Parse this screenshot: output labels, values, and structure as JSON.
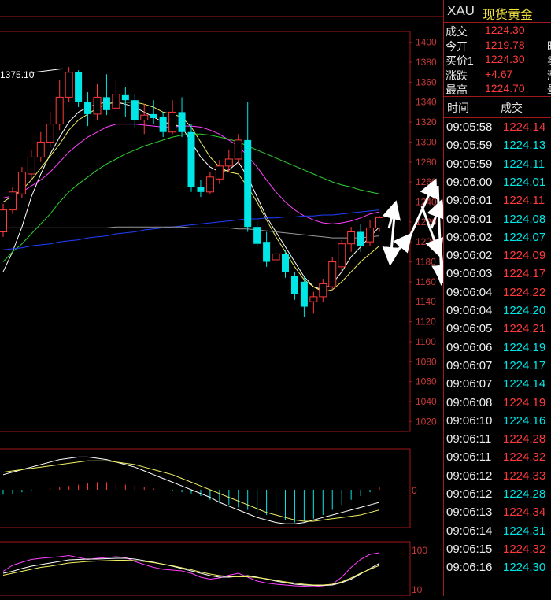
{
  "symbol": "XAU",
  "instrument_name": "现货黄金",
  "quote": [
    {
      "label": "成交",
      "value": "1224.30",
      "cut": ""
    },
    {
      "label": "今开",
      "value": "1219.78",
      "cut": "昨"
    },
    {
      "label": "买价1",
      "value": "1224.30",
      "cut": "卖"
    },
    {
      "label": "涨跌",
      "value": "+4.67",
      "cut": "涨"
    },
    {
      "label": "最高",
      "value": "1224.70",
      "cut": "最"
    }
  ],
  "ticks_header": {
    "time": "时间",
    "price": "成交"
  },
  "ticks": [
    {
      "time": "09:05:58",
      "price": "1224.14",
      "dir": "up"
    },
    {
      "time": "09:05:59",
      "price": "1224.13",
      "dir": "down"
    },
    {
      "time": "09:05:59",
      "price": "1224.11",
      "dir": "down"
    },
    {
      "time": "09:06:00",
      "price": "1224.01",
      "dir": "down"
    },
    {
      "time": "09:06:01",
      "price": "1224.11",
      "dir": "up"
    },
    {
      "time": "09:06:01",
      "price": "1224.08",
      "dir": "down"
    },
    {
      "time": "09:06:02",
      "price": "1224.07",
      "dir": "down"
    },
    {
      "time": "09:06:02",
      "price": "1224.09",
      "dir": "up"
    },
    {
      "time": "09:06:03",
      "price": "1224.17",
      "dir": "up"
    },
    {
      "time": "09:06:04",
      "price": "1224.22",
      "dir": "up"
    },
    {
      "time": "09:06:04",
      "price": "1224.20",
      "dir": "down"
    },
    {
      "time": "09:06:05",
      "price": "1224.21",
      "dir": "up"
    },
    {
      "time": "09:06:06",
      "price": "1224.19",
      "dir": "down"
    },
    {
      "time": "09:06:07",
      "price": "1224.17",
      "dir": "down"
    },
    {
      "time": "09:06:07",
      "price": "1224.14",
      "dir": "down"
    },
    {
      "time": "09:06:08",
      "price": "1224.19",
      "dir": "up"
    },
    {
      "time": "09:06:10",
      "price": "1224.16",
      "dir": "down"
    },
    {
      "time": "09:06:11",
      "price": "1224.28",
      "dir": "up"
    },
    {
      "time": "09:06:11",
      "price": "1224.32",
      "dir": "up"
    },
    {
      "time": "09:06:12",
      "price": "1224.33",
      "dir": "up"
    },
    {
      "time": "09:06:12",
      "price": "1224.28",
      "dir": "down"
    },
    {
      "time": "09:06:13",
      "price": "1224.34",
      "dir": "up"
    },
    {
      "time": "09:06:14",
      "price": "1224.31",
      "dir": "down"
    },
    {
      "time": "09:06:15",
      "price": "1224.32",
      "dir": "up"
    },
    {
      "time": "09:06:16",
      "price": "1224.30",
      "dir": "down"
    }
  ],
  "colors": {
    "up": "#ff3b3b",
    "down": "#00e6e6",
    "grid_border": "#a01818",
    "ma1": "#ffffff",
    "ma2": "#f0f060",
    "ma3": "#ff40ff",
    "ma4": "#30d030",
    "ma5": "#2040ff",
    "ma6": "#9a9a9a",
    "annotation_arrow": "#ffffff"
  },
  "chart_data": {
    "type": "candlestick",
    "price_axis": {
      "ylim": [
        1010,
        1410
      ],
      "ticks": [
        "1400",
        "1380",
        "1360",
        "1340",
        "1320",
        "1300",
        "1280",
        "1260",
        "1240",
        "1220",
        "1200",
        "1180",
        "1160",
        "1140",
        "1120",
        "1100",
        "1080",
        "1060",
        "1040",
        "1020"
      ]
    },
    "high_label": "1375.10",
    "candles": [
      {
        "o": 1210,
        "c": 1232,
        "h": 1238,
        "l": 1205
      },
      {
        "o": 1232,
        "c": 1250,
        "h": 1255,
        "l": 1228
      },
      {
        "o": 1248,
        "c": 1270,
        "h": 1275,
        "l": 1244
      },
      {
        "o": 1268,
        "c": 1285,
        "h": 1292,
        "l": 1262
      },
      {
        "o": 1285,
        "c": 1300,
        "h": 1310,
        "l": 1280
      },
      {
        "o": 1300,
        "c": 1318,
        "h": 1330,
        "l": 1295
      },
      {
        "o": 1318,
        "c": 1345,
        "h": 1362,
        "l": 1312
      },
      {
        "o": 1345,
        "c": 1370,
        "h": 1375.1,
        "l": 1340
      },
      {
        "o": 1370,
        "c": 1340,
        "h": 1372,
        "l": 1335
      },
      {
        "o": 1340,
        "c": 1328,
        "h": 1350,
        "l": 1316
      },
      {
        "o": 1328,
        "c": 1345,
        "h": 1358,
        "l": 1322
      },
      {
        "o": 1345,
        "c": 1332,
        "h": 1368,
        "l": 1327
      },
      {
        "o": 1334,
        "c": 1348,
        "h": 1362,
        "l": 1330
      },
      {
        "o": 1347,
        "c": 1342,
        "h": 1355,
        "l": 1325
      },
      {
        "o": 1342,
        "c": 1322,
        "h": 1348,
        "l": 1315
      },
      {
        "o": 1322,
        "c": 1327,
        "h": 1338,
        "l": 1308
      },
      {
        "o": 1328,
        "c": 1324,
        "h": 1342,
        "l": 1318
      },
      {
        "o": 1325,
        "c": 1310,
        "h": 1330,
        "l": 1305
      },
      {
        "o": 1310,
        "c": 1330,
        "h": 1342,
        "l": 1308
      },
      {
        "o": 1330,
        "c": 1310,
        "h": 1345,
        "l": 1305
      },
      {
        "o": 1310,
        "c": 1255,
        "h": 1318,
        "l": 1250
      },
      {
        "o": 1255,
        "c": 1250,
        "h": 1262,
        "l": 1245
      },
      {
        "o": 1250,
        "c": 1265,
        "h": 1270,
        "l": 1248
      },
      {
        "o": 1263,
        "c": 1276,
        "h": 1282,
        "l": 1258
      },
      {
        "o": 1276,
        "c": 1283,
        "h": 1292,
        "l": 1270
      },
      {
        "o": 1283,
        "c": 1302,
        "h": 1308,
        "l": 1278
      },
      {
        "o": 1302,
        "c": 1215,
        "h": 1340,
        "l": 1210
      },
      {
        "o": 1215,
        "c": 1198,
        "h": 1220,
        "l": 1195
      },
      {
        "o": 1200,
        "c": 1180,
        "h": 1210,
        "l": 1175
      },
      {
        "o": 1182,
        "c": 1188,
        "h": 1196,
        "l": 1172
      },
      {
        "o": 1188,
        "c": 1170,
        "h": 1192,
        "l": 1164
      },
      {
        "o": 1166,
        "c": 1148,
        "h": 1170,
        "l": 1142
      },
      {
        "o": 1160,
        "c": 1135,
        "h": 1165,
        "l": 1125
      },
      {
        "o": 1140,
        "c": 1145,
        "h": 1150,
        "l": 1128
      },
      {
        "o": 1145,
        "c": 1158,
        "h": 1163,
        "l": 1140
      },
      {
        "o": 1155,
        "c": 1180,
        "h": 1185,
        "l": 1152
      },
      {
        "o": 1175,
        "c": 1198,
        "h": 1202,
        "l": 1170
      },
      {
        "o": 1198,
        "c": 1210,
        "h": 1215,
        "l": 1190
      },
      {
        "o": 1210,
        "c": 1196,
        "h": 1218,
        "l": 1190
      },
      {
        "o": 1200,
        "c": 1214,
        "h": 1222,
        "l": 1196
      },
      {
        "o": 1214,
        "c": 1224.3,
        "h": 1226,
        "l": 1210
      }
    ],
    "moving_averages": [
      {
        "color": "ma1",
        "values": [
          1170,
          1190,
          1215,
          1245,
          1268,
          1288,
          1305,
          1320,
          1330,
          1335,
          1338,
          1340,
          1340,
          1338,
          1335,
          1330,
          1325,
          1320,
          1318,
          1315,
          1300,
          1285,
          1275,
          1270,
          1272,
          1280,
          1265,
          1245,
          1225,
          1210,
          1195,
          1180,
          1165,
          1155,
          1152,
          1158,
          1170,
          1185,
          1195,
          1205,
          1215
        ]
      },
      {
        "color": "ma2",
        "values": [
          1240,
          1246,
          1252,
          1262,
          1274,
          1286,
          1298,
          1312,
          1322,
          1328,
          1334,
          1338,
          1340,
          1340,
          1340,
          1338,
          1335,
          1330,
          1328,
          1325,
          1315,
          1300,
          1285,
          1275,
          1270,
          1268,
          1255,
          1240,
          1222,
          1205,
          1190,
          1175,
          1162,
          1155,
          1150,
          1152,
          1160,
          1170,
          1180,
          1188,
          1196
        ]
      },
      {
        "color": "ma3",
        "values": [
          1244,
          1246,
          1250,
          1256,
          1262,
          1270,
          1280,
          1290,
          1298,
          1305,
          1310,
          1315,
          1318,
          1318,
          1318,
          1317,
          1316,
          1315,
          1315,
          1316,
          1316,
          1315,
          1312,
          1308,
          1302,
          1296,
          1286,
          1275,
          1262,
          1250,
          1240,
          1232,
          1226,
          1222,
          1219,
          1218,
          1219,
          1221,
          1224,
          1228,
          1230
        ]
      },
      {
        "color": "ma4",
        "values": [
          1180,
          1190,
          1198,
          1208,
          1218,
          1228,
          1240,
          1250,
          1258,
          1265,
          1272,
          1278,
          1283,
          1288,
          1292,
          1296,
          1299,
          1302,
          1305,
          1307,
          1308,
          1308,
          1307,
          1305,
          1303,
          1300,
          1296,
          1292,
          1288,
          1284,
          1280,
          1276,
          1272,
          1268,
          1264,
          1260,
          1257,
          1255,
          1252,
          1250,
          1248
        ]
      },
      {
        "color": "ma5",
        "values": [
          1192,
          1193,
          1194,
          1196,
          1197,
          1198,
          1200,
          1201,
          1202,
          1204,
          1205,
          1206,
          1208,
          1209,
          1210,
          1212,
          1213,
          1214,
          1215,
          1216,
          1217,
          1218,
          1219,
          1220,
          1221,
          1222,
          1223,
          1223,
          1224,
          1224,
          1225,
          1225,
          1226,
          1226,
          1227,
          1227,
          1228,
          1229,
          1230,
          1231,
          1232
        ]
      },
      {
        "color": "ma6",
        "values": [
          1214,
          1214,
          1214,
          1214,
          1214,
          1214,
          1214,
          1214,
          1214,
          1214,
          1214,
          1214,
          1215,
          1215,
          1215,
          1215,
          1215,
          1215,
          1215,
          1215,
          1214,
          1214,
          1214,
          1214,
          1214,
          1213,
          1213,
          1212,
          1211,
          1210,
          1209,
          1208,
          1207,
          1206,
          1205,
          1204,
          1204,
          1204,
          1204,
          1205,
          1206
        ]
      }
    ],
    "macd": {
      "axis_ticks": [
        "0"
      ],
      "histogram": [
        -4,
        -3,
        -2,
        -1,
        0,
        1,
        2,
        3,
        4,
        5,
        6,
        6,
        5,
        4,
        3,
        2,
        1,
        0,
        -1,
        -2,
        -3,
        -5,
        -8,
        -10,
        -12,
        -14,
        -16,
        -18,
        -20,
        -22,
        -24,
        -26,
        -25,
        -23,
        -20,
        -16,
        -12,
        -8,
        -5,
        -2,
        2
      ],
      "dif": [
        12,
        14,
        16,
        18,
        20,
        22,
        24,
        25,
        26,
        26,
        25,
        24,
        22,
        20,
        18,
        15,
        12,
        9,
        6,
        3,
        0,
        -3,
        -6,
        -10,
        -13,
        -16,
        -19,
        -22,
        -24,
        -26,
        -27,
        -27,
        -26,
        -24,
        -22,
        -20,
        -18,
        -16,
        -14,
        -12,
        -10
      ],
      "dea": [
        14,
        15,
        16,
        17,
        18,
        19,
        20,
        21,
        22,
        23,
        23,
        23,
        22,
        21,
        20,
        18,
        16,
        14,
        12,
        9,
        6,
        3,
        0,
        -3,
        -6,
        -9,
        -12,
        -15,
        -18,
        -20,
        -22,
        -24,
        -25,
        -25,
        -24,
        -23,
        -22,
        -21,
        -20,
        -18,
        -16
      ]
    },
    "oscillator": {
      "axis_ticks": [
        "100",
        "10"
      ],
      "k": [
        45,
        60,
        68,
        75,
        78,
        80,
        82,
        85,
        80,
        75,
        78,
        80,
        82,
        80,
        70,
        62,
        55,
        50,
        48,
        46,
        40,
        30,
        25,
        28,
        35,
        40,
        30,
        20,
        15,
        12,
        10,
        8,
        7,
        6,
        8,
        12,
        30,
        55,
        75,
        88,
        92
      ],
      "d": [
        40,
        45,
        52,
        58,
        62,
        66,
        70,
        74,
        75,
        76,
        76,
        77,
        78,
        78,
        76,
        72,
        68,
        63,
        58,
        52,
        46,
        40,
        34,
        30,
        30,
        32,
        34,
        30,
        25,
        20,
        16,
        12,
        10,
        9,
        9,
        10,
        16,
        25,
        38,
        52,
        65
      ],
      "j": [
        35,
        40,
        45,
        50,
        55,
        58,
        62,
        66,
        68,
        70,
        71,
        72,
        73,
        73,
        72,
        70,
        67,
        63,
        59,
        54,
        49,
        43,
        38,
        34,
        32,
        31,
        31,
        29,
        26,
        22,
        18,
        15,
        12,
        10,
        10,
        12,
        18,
        28,
        40,
        50,
        60
      ]
    }
  }
}
